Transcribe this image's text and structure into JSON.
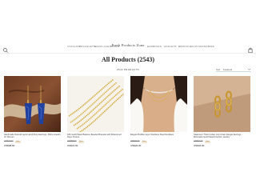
{
  "header": {
    "brand": "Fresh Products Zone",
    "nav_left": [
      "Catalog",
      "Bracelets",
      "Necklaces",
      "Rings"
    ],
    "nav_right": [
      "Earrings",
      "Anklets",
      "Brooches",
      "Accessories"
    ]
  },
  "collection": {
    "title": "All Products (2543)",
    "toolbar_label": "2543 PRODUCTS",
    "sort_label": "Sort",
    "sort_value": "Featured"
  },
  "products": [
    {
      "name": "Handmade Natural Lapis Lazuli Drop Earrings - Boho Jewelry for Women",
      "old_price": "US$72.00",
      "badge": "Sale",
      "price": "US$38.00"
    },
    {
      "name": "18K Gold Plated Balance Beaded Bracelet with Waterproof Rope Texture",
      "old_price": "US$58.00",
      "badge": "Sale",
      "price": "US$31.00"
    },
    {
      "name": "Elegant Bubble Layer Stainless Steel Necklace",
      "old_price": "US$49.00",
      "badge": "Sale",
      "price": "US$26.00"
    },
    {
      "name": "Statement Thick Cuban Link Chain Dangle Earrings - Minimalist Gold Plated Fashion Jewelry",
      "old_price": "US$64.00",
      "badge": "Sale",
      "price": "US$34.00"
    }
  ]
}
